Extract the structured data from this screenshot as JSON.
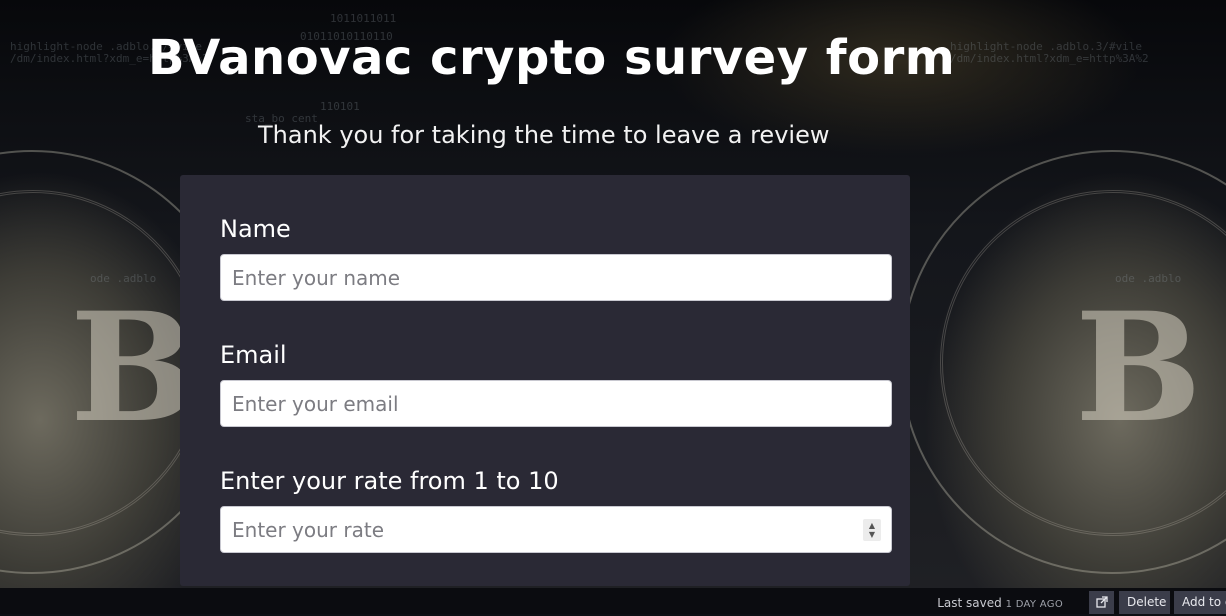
{
  "page": {
    "title": "BVanovac crypto survey form",
    "description": "Thank you for taking the time to leave a review"
  },
  "form": {
    "name_label": "Name",
    "name_placeholder": "Enter your name",
    "email_label": "Email",
    "email_placeholder": "Enter your email",
    "rate_label": "Enter your rate from 1 to 10",
    "rate_placeholder": "Enter your rate"
  },
  "footer": {
    "saved_label": "Last saved",
    "saved_time": "1 DAY AGO",
    "open_icon": "external-link-icon",
    "delete_label": "Delete",
    "add_label": "Add to c"
  },
  "colors": {
    "form_bg": "#2a2935",
    "title_text": "#ffffff",
    "footer_bg": "#0b0c10"
  }
}
